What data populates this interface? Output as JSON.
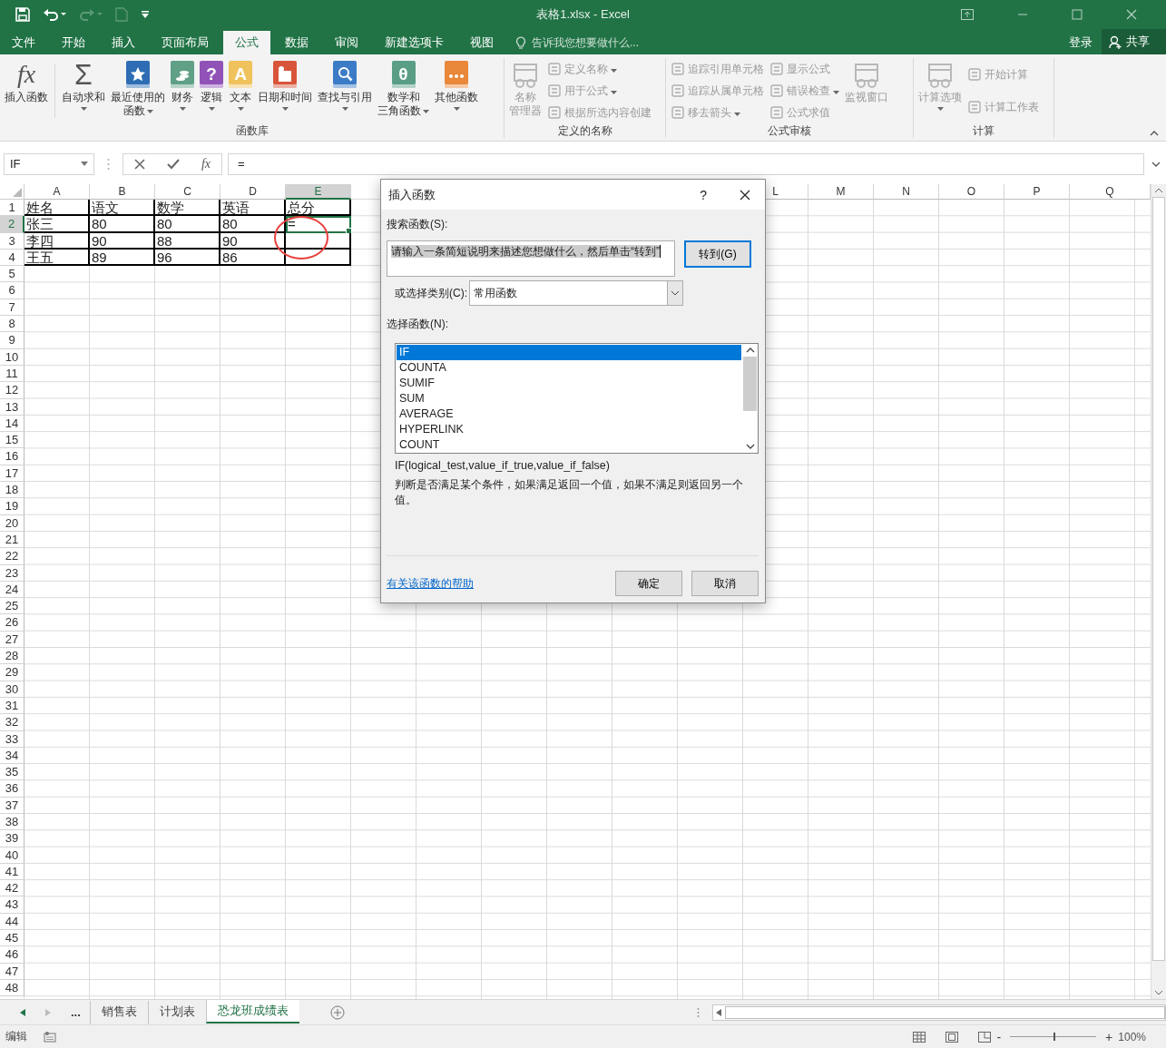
{
  "window": {
    "title": "表格1.xlsx - Excel"
  },
  "ribbon_tabs": [
    {
      "label": "文件",
      "selected": false
    },
    {
      "label": "开始",
      "selected": false
    },
    {
      "label": "插入",
      "selected": false
    },
    {
      "label": "页面布局",
      "selected": false
    },
    {
      "label": "公式",
      "selected": true
    },
    {
      "label": "数据",
      "selected": false
    },
    {
      "label": "审阅",
      "selected": false
    },
    {
      "label": "新建选项卡",
      "selected": false
    },
    {
      "label": "视图",
      "selected": false
    }
  ],
  "tell_me": {
    "placeholder": "告诉我您想要做什么..."
  },
  "account": {
    "sign_in": "登录",
    "share": "共享"
  },
  "ribbon_groups": [
    {
      "label": "函数库",
      "items": [
        {
          "kind": "big",
          "lines": [
            "插入函数"
          ],
          "glyph": "fx",
          "dropdown": false,
          "disabled": false
        },
        {
          "kind": "big",
          "lines": [
            "自动求和"
          ],
          "glyph": "Σ",
          "dropdown": true,
          "disabled": false
        },
        {
          "kind": "big",
          "lines": [
            "最近使用的",
            "函数"
          ],
          "dropdown": true,
          "disabled": false
        },
        {
          "kind": "big",
          "lines": [
            "财务"
          ],
          "dropdown": true,
          "disabled": false
        },
        {
          "kind": "big",
          "lines": [
            "逻辑"
          ],
          "glyph": "?",
          "dropdown": true,
          "disabled": false
        },
        {
          "kind": "big",
          "lines": [
            "文本"
          ],
          "glyph": "A",
          "dropdown": true,
          "disabled": false
        },
        {
          "kind": "big",
          "lines": [
            "日期和时间"
          ],
          "dropdown": true,
          "disabled": false
        },
        {
          "kind": "big",
          "lines": [
            "查找与引用"
          ],
          "dropdown": true,
          "disabled": false
        },
        {
          "kind": "big",
          "lines": [
            "数学和",
            "三角函数"
          ],
          "glyph": "θ",
          "dropdown": true,
          "disabled": false
        },
        {
          "kind": "big",
          "lines": [
            "其他函数"
          ],
          "dropdown": true,
          "disabled": false
        }
      ]
    },
    {
      "label": "定义的名称",
      "items": [
        {
          "kind": "big",
          "lines": [
            "名称",
            "管理器"
          ],
          "dropdown": false,
          "disabled": true
        },
        {
          "kind": "small",
          "lines": [
            "定义名称"
          ],
          "dropdown": true,
          "disabled": true
        },
        {
          "kind": "small",
          "lines": [
            "用于公式"
          ],
          "dropdown": true,
          "disabled": true
        },
        {
          "kind": "small",
          "lines": [
            "根据所选内容创建"
          ],
          "dropdown": false,
          "disabled": true
        }
      ]
    },
    {
      "label": "公式审核",
      "items": [
        {
          "kind": "small",
          "lines": [
            "追踪引用单元格"
          ],
          "dropdown": false,
          "disabled": true
        },
        {
          "kind": "small",
          "lines": [
            "追踪从属单元格"
          ],
          "dropdown": false,
          "disabled": true
        },
        {
          "kind": "small",
          "lines": [
            "移去箭头"
          ],
          "dropdown": true,
          "disabled": true
        },
        {
          "kind": "small",
          "lines": [
            "显示公式"
          ],
          "dropdown": false,
          "disabled": true
        },
        {
          "kind": "small",
          "lines": [
            "错误检查"
          ],
          "dropdown": true,
          "disabled": true
        },
        {
          "kind": "small",
          "lines": [
            "公式求值"
          ],
          "dropdown": false,
          "disabled": true
        },
        {
          "kind": "big",
          "lines": [
            "监视窗口"
          ],
          "dropdown": false,
          "disabled": true
        }
      ]
    },
    {
      "label": "计算",
      "items": [
        {
          "kind": "big",
          "lines": [
            "计算选项"
          ],
          "dropdown": true,
          "disabled": true
        },
        {
          "kind": "small",
          "lines": [
            "开始计算"
          ],
          "dropdown": false,
          "disabled": true
        },
        {
          "kind": "small",
          "lines": [
            "计算工作表"
          ],
          "dropdown": false,
          "disabled": true
        }
      ]
    }
  ],
  "formula_bar": {
    "name_box": "IF",
    "fx": "fx",
    "formula": "="
  },
  "sheet": {
    "columns": [
      {
        "label": "A",
        "selected": false
      },
      {
        "label": "B",
        "selected": false
      },
      {
        "label": "C",
        "selected": false
      },
      {
        "label": "D",
        "selected": false
      },
      {
        "label": "E",
        "selected": true
      },
      {
        "label": "L",
        "selected": false
      },
      {
        "label": "M",
        "selected": false
      },
      {
        "label": "N",
        "selected": false
      },
      {
        "label": "O",
        "selected": false
      },
      {
        "label": "P",
        "selected": false
      },
      {
        "label": "Q",
        "selected": false
      }
    ],
    "rows": [
      {
        "label": "1",
        "selected": false
      },
      {
        "label": "2",
        "selected": true
      },
      {
        "label": "3",
        "selected": false
      },
      {
        "label": "4",
        "selected": false
      },
      {
        "label": "5",
        "selected": false
      },
      {
        "label": "6",
        "selected": false
      },
      {
        "label": "7",
        "selected": false
      },
      {
        "label": "8",
        "selected": false
      },
      {
        "label": "9",
        "selected": false
      },
      {
        "label": "10",
        "selected": false
      },
      {
        "label": "11",
        "selected": false
      },
      {
        "label": "12",
        "selected": false
      },
      {
        "label": "13",
        "selected": false
      },
      {
        "label": "14",
        "selected": false
      },
      {
        "label": "15",
        "selected": false
      },
      {
        "label": "16",
        "selected": false
      },
      {
        "label": "17",
        "selected": false
      },
      {
        "label": "18",
        "selected": false
      },
      {
        "label": "19",
        "selected": false
      },
      {
        "label": "20",
        "selected": false
      },
      {
        "label": "21",
        "selected": false
      },
      {
        "label": "22",
        "selected": false
      },
      {
        "label": "23",
        "selected": false
      },
      {
        "label": "24",
        "selected": false
      },
      {
        "label": "25",
        "selected": false
      },
      {
        "label": "26",
        "selected": false
      },
      {
        "label": "27",
        "selected": false
      },
      {
        "label": "28",
        "selected": false
      },
      {
        "label": "29",
        "selected": false
      },
      {
        "label": "30",
        "selected": false
      },
      {
        "label": "31",
        "selected": false
      },
      {
        "label": "32",
        "selected": false
      },
      {
        "label": "33",
        "selected": false
      },
      {
        "label": "34",
        "selected": false
      },
      {
        "label": "35",
        "selected": false
      },
      {
        "label": "36",
        "selected": false
      },
      {
        "label": "37",
        "selected": false
      },
      {
        "label": "38",
        "selected": false
      },
      {
        "label": "39",
        "selected": false
      },
      {
        "label": "40",
        "selected": false
      },
      {
        "label": "41",
        "selected": false
      },
      {
        "label": "42",
        "selected": false
      },
      {
        "label": "43",
        "selected": false
      },
      {
        "label": "44",
        "selected": false
      },
      {
        "label": "45",
        "selected": false
      },
      {
        "label": "46",
        "selected": false
      },
      {
        "label": "47",
        "selected": false
      },
      {
        "label": "48",
        "selected": false
      }
    ],
    "cells": [
      [
        {
          "text": "姓名",
          "selected": false
        },
        {
          "text": "语文",
          "selected": false
        },
        {
          "text": "数学",
          "selected": false
        },
        {
          "text": "英语",
          "selected": false
        },
        {
          "text": "总分",
          "selected": false
        }
      ],
      [
        {
          "text": "张三",
          "selected": false
        },
        {
          "text": "80",
          "selected": false
        },
        {
          "text": "80",
          "selected": false
        },
        {
          "text": "80",
          "selected": false
        },
        {
          "text": "=",
          "selected": true
        }
      ],
      [
        {
          "text": "李四",
          "selected": false
        },
        {
          "text": "90",
          "selected": false
        },
        {
          "text": "88",
          "selected": false
        },
        {
          "text": "90",
          "selected": false
        },
        {
          "text": "",
          "selected": false
        }
      ],
      [
        {
          "text": "王五",
          "selected": false
        },
        {
          "text": "89",
          "selected": false
        },
        {
          "text": "96",
          "selected": false
        },
        {
          "text": "86",
          "selected": false
        },
        {
          "text": "",
          "selected": false
        }
      ]
    ]
  },
  "dialog": {
    "title": "插入函数",
    "help": "?",
    "search_label": "搜索函数(S):",
    "search_value": "请输入一条简短说明来描述您想做什么，然后单击“转到”",
    "go": "转到(G)",
    "category_label": "或选择类别(C):",
    "category": "常用函数",
    "list_label": "选择函数(N):",
    "functions": [
      {
        "name": "IF",
        "selected": true
      },
      {
        "name": "COUNTA",
        "selected": false
      },
      {
        "name": "SUMIF",
        "selected": false
      },
      {
        "name": "SUM",
        "selected": false
      },
      {
        "name": "AVERAGE",
        "selected": false
      },
      {
        "name": "HYPERLINK",
        "selected": false
      },
      {
        "name": "COUNT",
        "selected": false
      }
    ],
    "syntax": "IF(logical_test,value_if_true,value_if_false)",
    "description": "判断是否满足某个条件，如果满足返回一个值，如果不满足则返回另一个值。",
    "help_link": "有关该函数的帮助",
    "ok": "确定",
    "cancel": "取消"
  },
  "sheet_tabs": {
    "more": "...",
    "tabs": [
      {
        "label": "销售表",
        "selected": false
      },
      {
        "label": "计划表",
        "selected": false
      },
      {
        "label": "恐龙班成绩表",
        "selected": true
      }
    ]
  },
  "status_bar": {
    "mode": "编辑",
    "zoom_out": "-",
    "zoom_in": "+",
    "zoom_level": {
      "level": 0.5
    },
    "zoom": "100%"
  }
}
